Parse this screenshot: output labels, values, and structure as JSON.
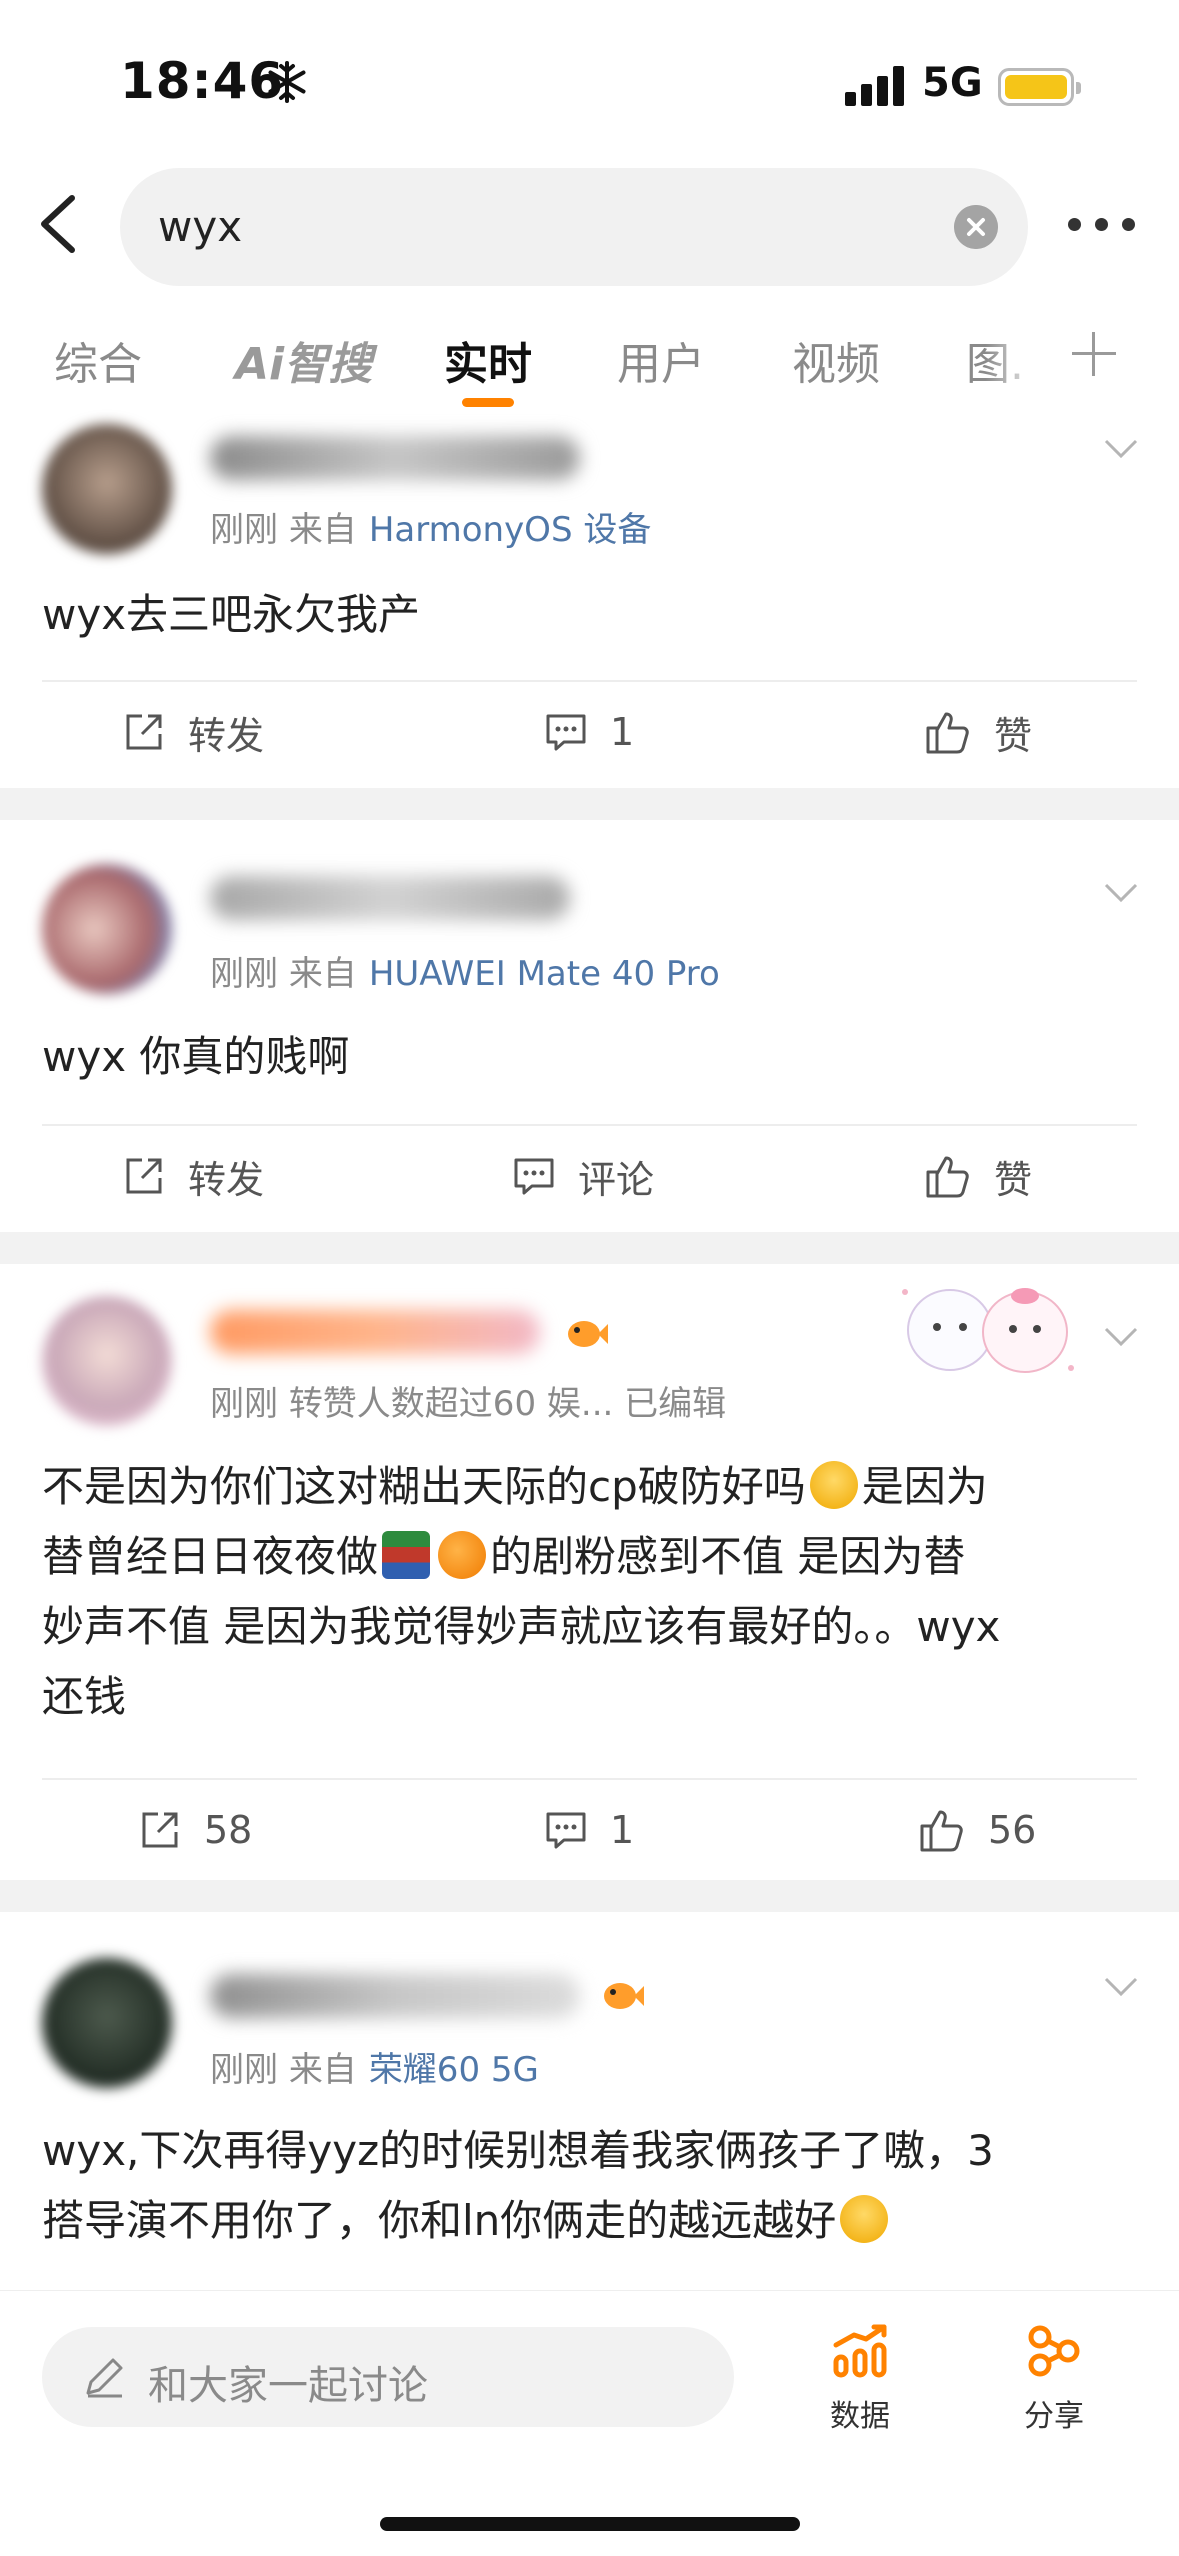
{
  "status_bar": {
    "time": "18:46",
    "network": "5G"
  },
  "search": {
    "query": "wyx"
  },
  "tabs": [
    {
      "label": "综合"
    },
    {
      "label": "Ai智搜"
    },
    {
      "label": "实时"
    },
    {
      "label": "用户"
    },
    {
      "label": "视频"
    },
    {
      "label": "图."
    }
  ],
  "active_tab": "实时",
  "posts": [
    {
      "meta_time": "刚刚",
      "meta_label": "来自",
      "meta_source": "HarmonyOS 设备",
      "content": "wyx去三吧永欠我产",
      "repost_label": "转发",
      "comment_label": "1",
      "like_label": "赞"
    },
    {
      "meta_time": "刚刚",
      "meta_label": "来自",
      "meta_source": "HUAWEI Mate 40 Pro",
      "content": "wyx 你真的贱啊",
      "repost_label": "转发",
      "comment_label": "评论",
      "like_label": "赞"
    },
    {
      "meta_time": "刚刚",
      "meta_extra": "转赞人数超过60",
      "meta_tag": "娱...",
      "meta_edited": "已编辑",
      "content_line1": "不是因为你们这对糊出天际的cp破防好吗",
      "content_line1b": "是因为",
      "content_line2a": "替曾经日日夜夜做",
      "content_line2b": "的剧粉感到不值 是因为替",
      "content_line3": "妙声不值 是因为我觉得妙声就应该有最好的。。wyx",
      "content_line4": "还钱",
      "repost_label": "58",
      "comment_label": "1",
      "like_label": "56"
    },
    {
      "meta_time": "刚刚",
      "meta_label": "来自",
      "meta_source": "荣耀60 5G",
      "content_line1": "wyx,下次再得yyz的时候别想着我家俩孩子了嗷，3",
      "content_line2": "搭导演不用你了，你和ln你俩走的越远越好"
    }
  ],
  "bottom_bar": {
    "discuss_placeholder": "和大家一起讨论",
    "data_label": "数据",
    "share_label": "分享"
  },
  "colors": {
    "accent": "#ff8200",
    "link": "#4f77a8"
  }
}
